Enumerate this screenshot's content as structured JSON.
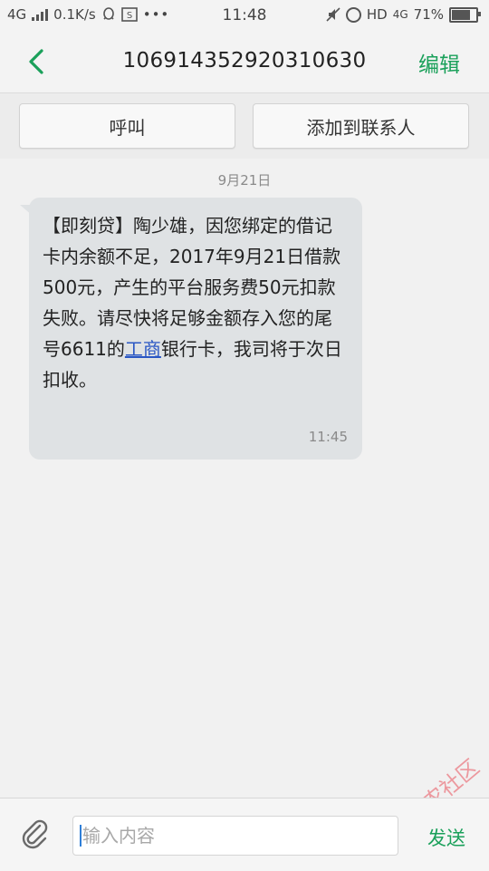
{
  "status_bar": {
    "network": "4G",
    "speed": "0.1K/s",
    "time": "11:48",
    "hd": "HD",
    "network_right": "4G",
    "battery": "71%",
    "icons": [
      "signal-icon",
      "qq-icon",
      "sim-s-icon",
      "more-dots-icon",
      "mute-icon",
      "alarm-icon",
      "battery-icon"
    ]
  },
  "header": {
    "title": "106914352920310630",
    "edit_label": "编辑",
    "back_icon": "back-chevron-icon"
  },
  "actions": {
    "call_label": "呼叫",
    "add_contact_label": "添加到联系人"
  },
  "conversation": {
    "date": "9月21日",
    "message": {
      "text_before_link": "【即刻贷】陶少雄，因您绑定的借记卡内余额不足，2017年9月21日借款500元，产生的平台服务费50元扣款失败。请尽快将足够金额存入您的尾号6611的",
      "link_text": "工商",
      "text_after_link": "银行卡，我司将于次日扣收。",
      "time": "11:45"
    }
  },
  "watermark": {
    "text": "卡农社区"
  },
  "composer": {
    "placeholder": "输入内容",
    "send_label": "发送",
    "attach_icon": "paperclip-icon"
  },
  "colors": {
    "accent": "#1aa05a",
    "bubble": "#dfe2e4",
    "link": "#2a57c4",
    "watermark": "#e8505b"
  }
}
